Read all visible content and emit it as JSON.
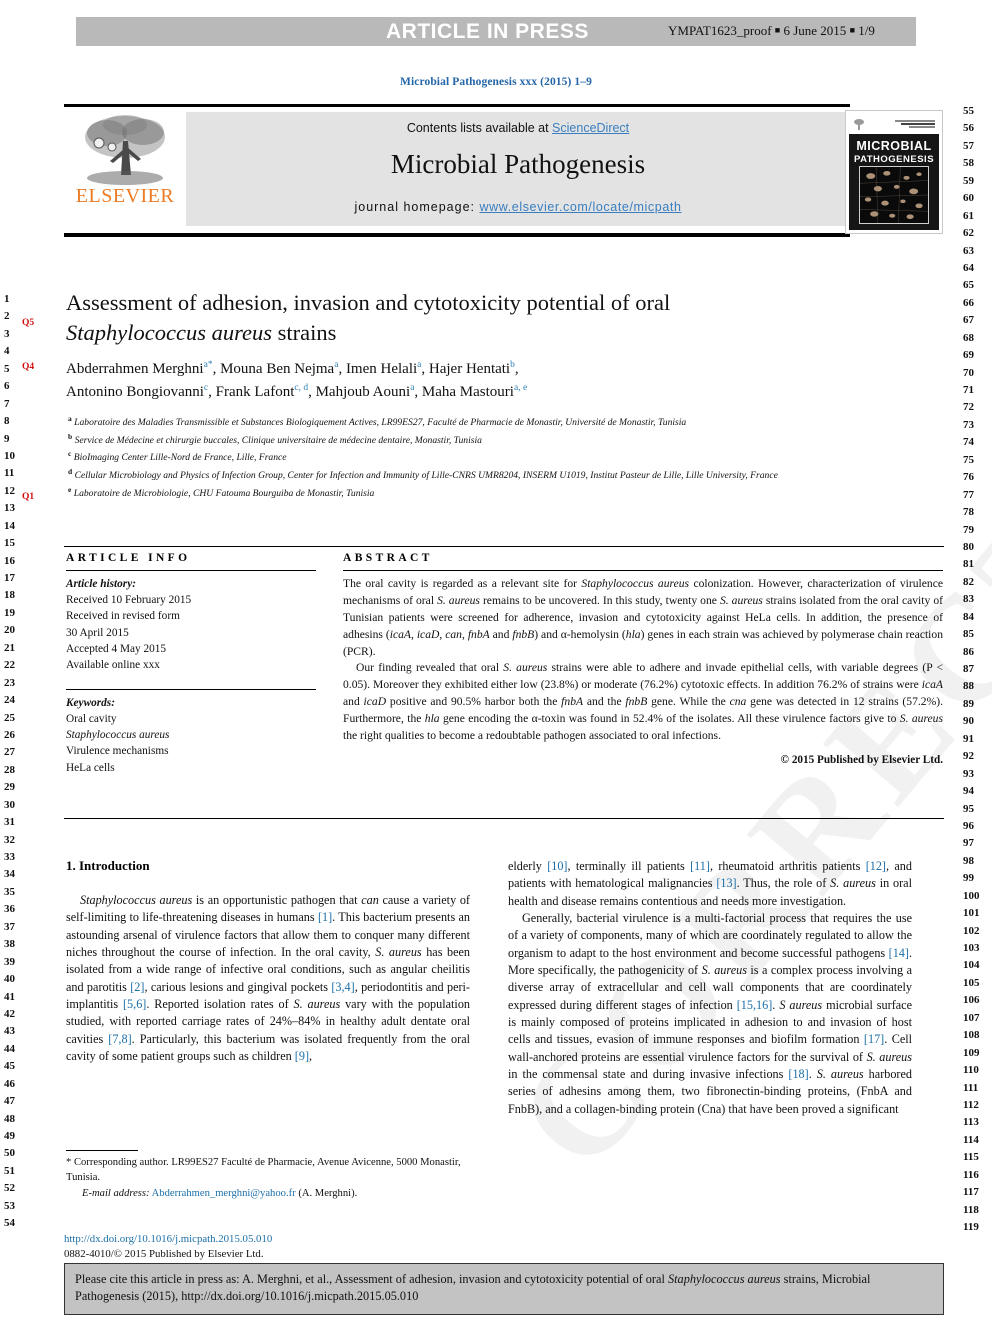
{
  "banner": {
    "press_title": "ARTICLE IN PRESS",
    "proof_meta_1": "YMPAT1623_proof",
    "proof_meta_2": "6 June 2015",
    "proof_meta_3": "1/9"
  },
  "journal_ref": "Microbial Pathogenesis xxx (2015) 1–9",
  "masthead": {
    "contents_prefix": "Contents lists available at ",
    "sciencedirect": "ScienceDirect",
    "journal_name": "Microbial Pathogenesis",
    "homepage_label": "journal homepage: ",
    "homepage_url": "www.elsevier.com/locate/micpath",
    "publisher": "ELSEVIER"
  },
  "cover": {
    "line1": "MICROBIAL",
    "line2": "PATHOGENESIS"
  },
  "title": {
    "line1": "Assessment of adhesion, invasion and cytotoxicity potential of oral",
    "line2_italic": "Staphylococcus aureus",
    "line2_rest": " strains"
  },
  "q_markers": {
    "q5": "Q5",
    "q4": "Q4",
    "q1": "Q1"
  },
  "authors": {
    "line1": "Abderrahmen Merghni",
    "a1": "a",
    "star": "*",
    "a2_name": "Mouna Ben Nejma",
    "a2": "a",
    "a3_name": "Imen Helali",
    "a3": "a",
    "a4_name": "Hajer Hentati",
    "a4": "b",
    "b1_name": "Antonino Bongiovanni",
    "b1": "c",
    "b2_name": "Frank Lafont",
    "b2": "c, d",
    "b3_name": "Mahjoub Aouni",
    "b3": "a",
    "b4_name": "Maha Mastouri",
    "b4": "a, e"
  },
  "affiliations": [
    {
      "mark": "a",
      "text": "Laboratoire des Maladies Transmissible et Substances Biologiquement Actives, LR99ES27, Faculté de Pharmacie de Monastir, Université de Monastir, Tunisia"
    },
    {
      "mark": "b",
      "text": "Service de Médecine et chirurgie buccales, Clinique universitaire de médecine dentaire, Monastir, Tunisia"
    },
    {
      "mark": "c",
      "text": "BioImaging Center Lille-Nord de France, Lille, France"
    },
    {
      "mark": "d",
      "text": "Cellular Microbiology and Physics of Infection Group, Center for Infection and Immunity of Lille-CNRS UMR8204, INSERM U1019, Institut Pasteur de Lille, Lille University, France"
    },
    {
      "mark": "e",
      "text": "Laboratoire de Microbiologie, CHU Fatouma Bourguiba de Monastir, Tunisia"
    }
  ],
  "article_info": {
    "heading": "ARTICLE INFO",
    "history_label": "Article history:",
    "history_lines": [
      "Received 10 February 2015",
      "Received in revised form",
      "30 April 2015",
      "Accepted 4 May 2015",
      "Available online xxx"
    ],
    "keywords_label": "Keywords:",
    "keywords": [
      "Oral cavity",
      "Staphylococcus aureus",
      "Virulence mechanisms",
      "HeLa cells"
    ]
  },
  "abstract": {
    "heading": "ABSTRACT",
    "para1": "The oral cavity is regarded as a relevant site for Staphylococcus aureus colonization. However, characterization of virulence mechanisms of oral S. aureus remains to be uncovered. In this study, twenty one S. aureus strains isolated from the oral cavity of Tunisian patients were screened for adherence, invasion and cytotoxicity against HeLa cells. In addition, the presence of adhesins (icaA, icaD, can, fnbA and fnbB) and α-hemolysin (hla) genes in each strain was achieved by polymerase chain reaction (PCR).",
    "para2": "Our finding revealed that oral S. aureus strains were able to adhere and invade epithelial cells, with variable degrees (P < 0.05). Moreover they exhibited either low (23.8%) or moderate (76.2%) cytotoxic effects. In addition 76.2% of strains were icaA and icaD positive and 90.5% harbor both the fnbA and the fnbB gene. While the cna gene was detected in 12 strains (57.2%). Furthermore, the hla gene encoding the α-toxin was found in 52.4% of the isolates. All these virulence factors give to S. aureus the right qualities to become a redoubtable pathogen associated to oral infections.",
    "copyright": "© 2015 Published by Elsevier Ltd."
  },
  "intro": {
    "section_title": "1. Introduction",
    "left_para": "Staphylococcus aureus is an opportunistic pathogen that can cause a variety of self-limiting to life-threatening diseases in humans [1]. This bacterium presents an astounding arsenal of virulence factors that allow them to conquer many different niches throughout the course of infection. In the oral cavity, S. aureus has been isolated from a wide range of infective oral conditions, such as angular cheilitis and parotitis [2], carious lesions and gingival pockets [3,4], periodontitis and peri-implantitis [5,6]. Reported isolation rates of S. aureus vary with the population studied, with reported carriage rates of 24%–84% in healthy adult dentate oral cavities [7,8]. Particularly, this bacterium was isolated frequently from the oral cavity of some patient groups such as children [9],",
    "right_para1": "elderly [10], terminally ill patients [11], rheumatoid arthritis patients [12], and patients with hematological malignancies [13]. Thus, the role of S. aureus in oral health and disease remains contentious and needs more investigation.",
    "right_para2": "Generally, bacterial virulence is a multi-factorial process that requires the use of a variety of components, many of which are coordinately regulated to allow the organism to adapt to the host environment and become successful pathogens [14]. More specifically, the pathogenicity of S. aureus is a complex process involving a diverse array of extracellular and cell wall components that are coordinately expressed during different stages of infection [15,16]. S aureus microbial surface is mainly composed of proteins implicated in adhesion to and invasion of host cells and tissues, evasion of immune responses and biofilm formation [17]. Cell wall-anchored proteins are essential virulence factors for the survival of S. aureus in the commensal state and during invasive infections [18]. S. aureus harbored series of adhesins among them, two fibronectin-binding proteins, (FnbA and FnbB), and a collagen-binding protein (Cna) that have been proved a significant"
  },
  "footnote": {
    "corresponding": "* Corresponding author. LR99ES27 Faculté de Pharmacie, Avenue Avicenne, 5000 Monastir, Tunisia.",
    "email_label": "E-mail address:",
    "email": "Abderrahmen_merghni@yahoo.fr",
    "email_suffix": "(A. Merghni).",
    "doi": "http://dx.doi.org/10.1016/j.micpath.2015.05.010",
    "issn_line": "0882-4010/© 2015 Published by Elsevier Ltd."
  },
  "cite_footer": {
    "prefix": "Please cite this article in press as: A. Merghni, et al., Assessment of adhesion, invasion and cytotoxicity potential of oral ",
    "italic": "Staphylococcus aureus",
    "suffix": " strains, Microbial Pathogenesis (2015), http://dx.doi.org/10.1016/j.micpath.2015.05.010"
  },
  "watermark": "CORRECTED PROOF",
  "line_numbers": {
    "left_start": 1,
    "left_end": 54,
    "right_start": 55,
    "right_end": 119
  },
  "colors": {
    "link": "#1b6fa8",
    "banner_bg": "#b9b9b9",
    "elsevier_orange": "#ec7b23",
    "q_red": "#d01010"
  }
}
